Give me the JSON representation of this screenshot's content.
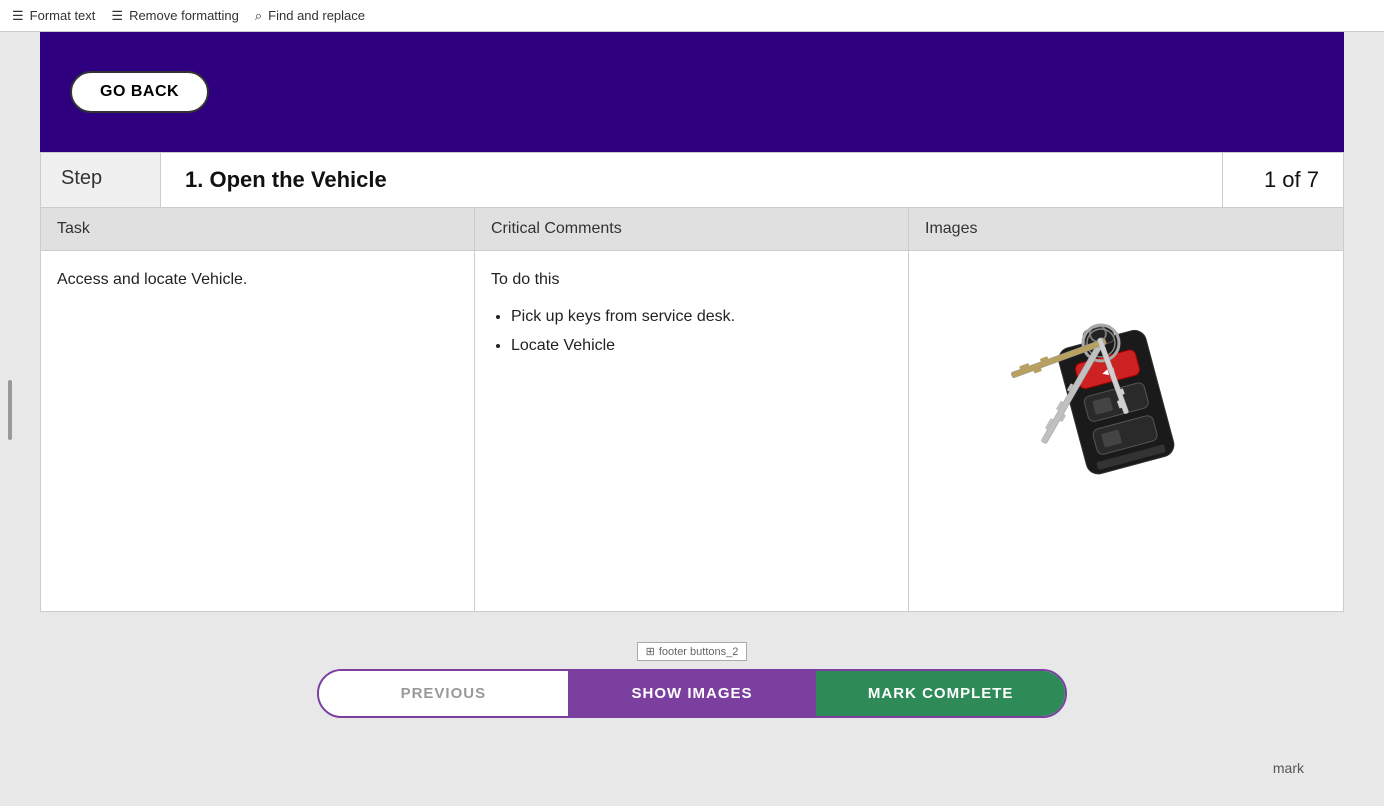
{
  "toolbar": {
    "format_text_label": "Format text",
    "remove_formatting_label": "Remove formatting",
    "find_replace_label": "Find and replace"
  },
  "header": {
    "go_back_label": "GO BACK",
    "background_color": "#2e0080"
  },
  "step": {
    "label": "Step",
    "title": "1. Open the Vehicle",
    "counter": "1 of 7"
  },
  "table": {
    "headers": [
      "Task",
      "Critical Comments",
      "Images"
    ],
    "task_text": "Access and locate Vehicle.",
    "comments_intro": "To do this",
    "comments_items": [
      "Pick up keys from service desk.",
      "Locate Vehicle"
    ]
  },
  "footer": {
    "label_text": "footer buttons_2",
    "previous_label": "PREVIOUS",
    "show_images_label": "SHOW IMAGES",
    "mark_complete_label": "MARK COMPLETE",
    "mark_label": "mark"
  }
}
